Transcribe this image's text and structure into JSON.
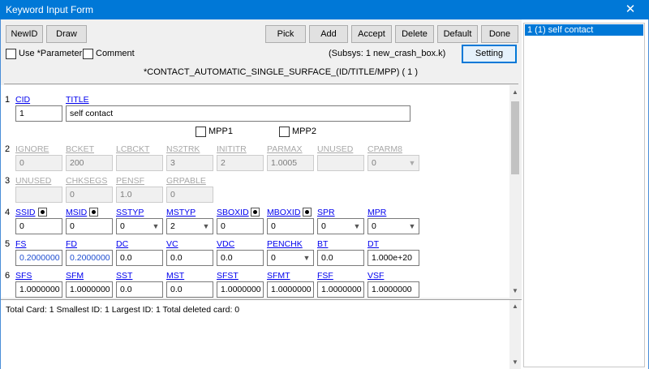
{
  "window": {
    "title": "Keyword Input Form",
    "close_glyph": "✕"
  },
  "toolbar": {
    "newid": "NewID",
    "draw": "Draw",
    "pick": "Pick",
    "add": "Add",
    "accept": "Accept",
    "delete": "Delete",
    "default": "Default",
    "done": "Done",
    "setting": "Setting"
  },
  "options": {
    "use_parameter": "Use *Parameter",
    "comment": "Comment",
    "subsys": "(Subsys: 1 new_crash_box.k)"
  },
  "keyword_title": "*CONTACT_AUTOMATIC_SINGLE_SURFACE_(ID/TITLE/MPP)    ( 1 )",
  "cards": {
    "r1": {
      "num": "1",
      "cid_label": "CID",
      "title_label": "TITLE",
      "cid": "1",
      "title": "self contact"
    },
    "mpp": {
      "mpp1": "MPP1",
      "mpp2": "MPP2"
    },
    "r2": {
      "num": "2",
      "labels": [
        "IGNORE",
        "BCKET",
        "LCBCKT",
        "NS2TRK",
        "INITITR",
        "PARMAX",
        "UNUSED",
        "CPARM8"
      ],
      "values": [
        "0",
        "200",
        "",
        "3",
        "2",
        "1.0005",
        "",
        "0"
      ]
    },
    "r3": {
      "num": "3",
      "labels": [
        "UNUSED",
        "CHKSEGS",
        "PENSF",
        "GRPABLE"
      ],
      "values": [
        "",
        "0",
        "1.0",
        "0"
      ]
    },
    "r4": {
      "num": "4",
      "labels": [
        "SSID",
        "MSID",
        "SSTYP",
        "MSTYP",
        "SBOXID",
        "MBOXID",
        "SPR",
        "MPR"
      ],
      "values": [
        "0",
        "0",
        "0",
        "2",
        "0",
        "0",
        "0",
        "0"
      ]
    },
    "r5": {
      "num": "5",
      "labels": [
        "FS",
        "FD",
        "DC",
        "VC",
        "VDC",
        "PENCHK",
        "BT",
        "DT"
      ],
      "values": [
        "0.2000000",
        "0.2000000",
        "0.0",
        "0.0",
        "0.0",
        "0",
        "0.0",
        "1.000e+20"
      ]
    },
    "r6": {
      "num": "6",
      "labels": [
        "SFS",
        "SFM",
        "SST",
        "MST",
        "SFST",
        "SFMT",
        "FSF",
        "VSF"
      ],
      "values": [
        "1.0000000",
        "1.0000000",
        "0.0",
        "0.0",
        "1.0000000",
        "1.0000000",
        "1.0000000",
        "1.0000000"
      ]
    }
  },
  "info": {
    "summary": "Total Card: 1    Smallest ID: 1    Largest ID: 1    Total deleted card:  0"
  },
  "list": {
    "item": "1   (1) self contact"
  }
}
